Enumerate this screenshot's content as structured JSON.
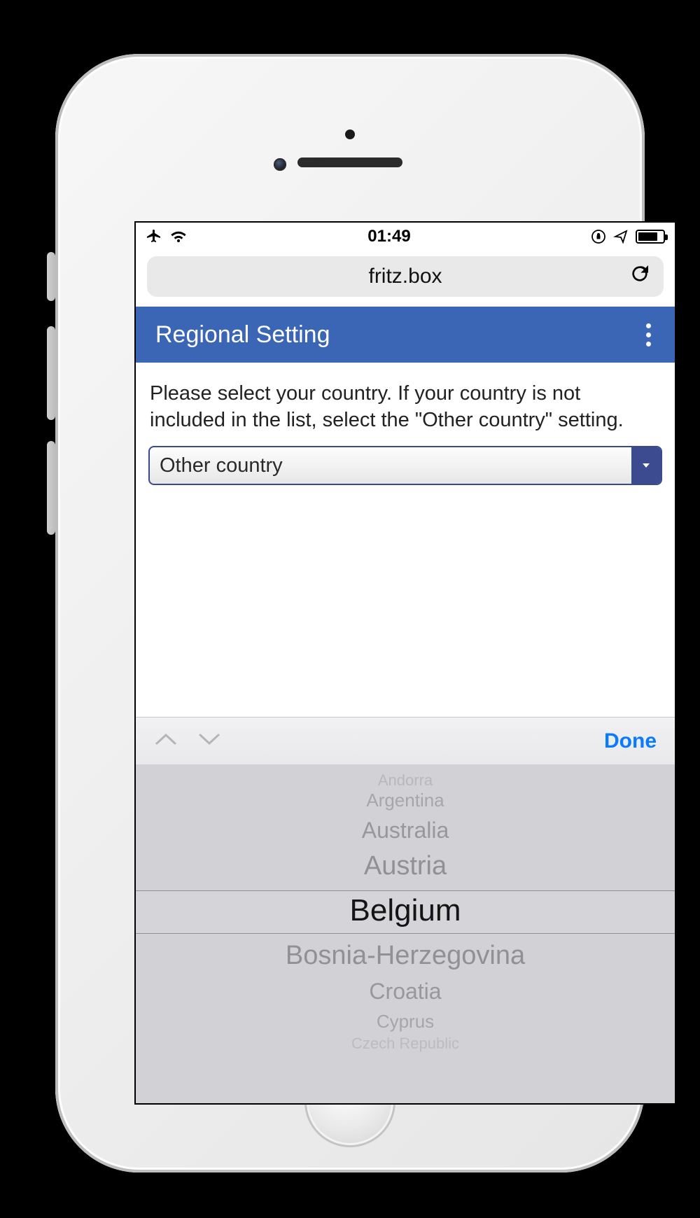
{
  "status": {
    "time": "01:49"
  },
  "browser": {
    "address": "fritz.box"
  },
  "header": {
    "title": "Regional Setting"
  },
  "body": {
    "instruction": "Please select your country. If your country is not included in the list, select the \"Other country\" setting.",
    "selected_value": "Other country"
  },
  "accessory": {
    "done_label": "Done"
  },
  "picker": {
    "options": [
      "Andorra",
      "Argentina",
      "Australia",
      "Austria",
      "Belgium",
      "Bosnia-Herzegovina",
      "Croatia",
      "Cyprus",
      "Czech Republic"
    ],
    "selected_index": 4
  }
}
